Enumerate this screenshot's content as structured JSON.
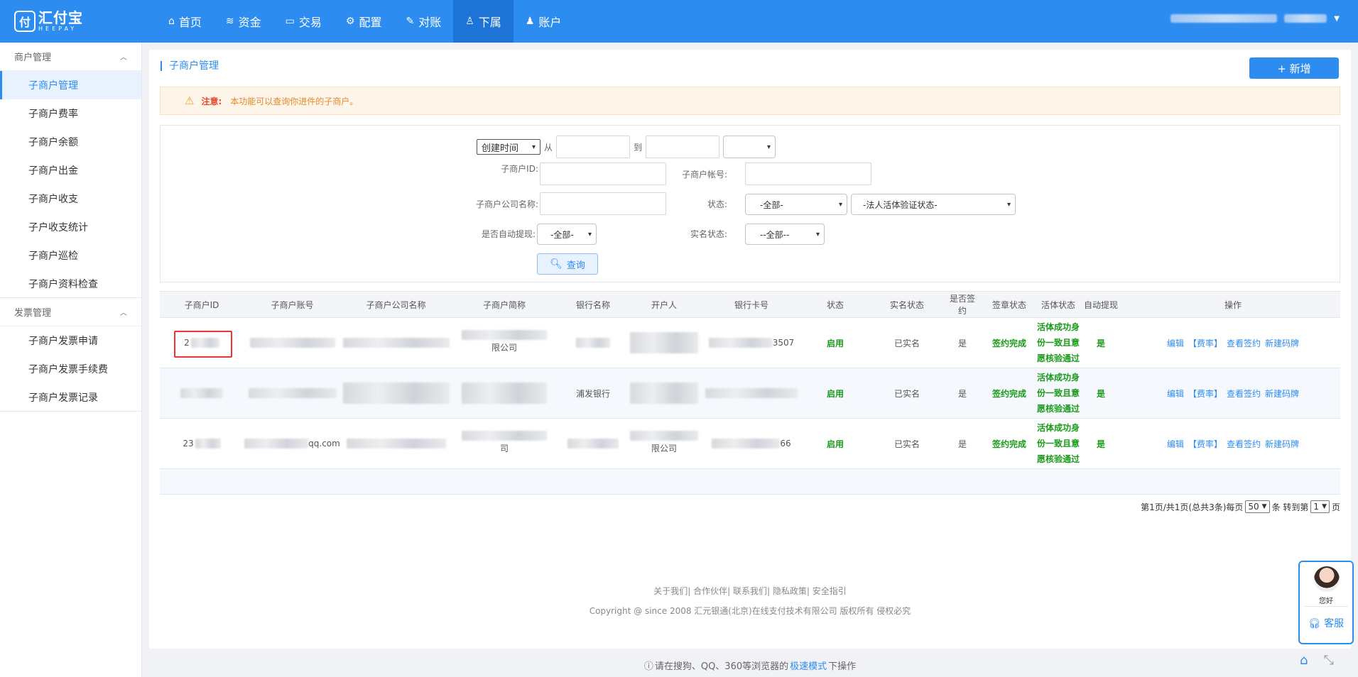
{
  "brand": {
    "logo_mark": "付",
    "name_cn": "汇付宝",
    "name_en": "HEEPAY"
  },
  "nav": [
    {
      "label": "首页",
      "icon": "home-icon"
    },
    {
      "label": "资金",
      "icon": "coins-icon"
    },
    {
      "label": "交易",
      "icon": "folder-icon"
    },
    {
      "label": "配置",
      "icon": "gear-icon"
    },
    {
      "label": "对账",
      "icon": "edit-icon"
    },
    {
      "label": "下属",
      "icon": "user-outline-icon",
      "active": true
    },
    {
      "label": "账户",
      "icon": "user-icon"
    }
  ],
  "sidebar": {
    "group1": "商户管理",
    "items1": [
      "子商户管理",
      "子商户费率",
      "子商户余额",
      "子商户出金",
      "子商户收支",
      "子户收支统计",
      "子商户巡检",
      "子商户资料检查"
    ],
    "group2": "发票管理",
    "items2": [
      "子商户发票申请",
      "子商户发票手续费",
      "子商户发票记录"
    ]
  },
  "page": {
    "breadcrumb": "子商户管理",
    "add_label": "+ 新增",
    "notice_label": "注意:",
    "notice_msg": "本功能可以查询你进件的子商户。"
  },
  "filter": {
    "time_select": "创建时间",
    "from": "从",
    "to": "到",
    "id_label": "子商户ID:",
    "account_label": "子商户帐号:",
    "company_label": "子商户公司名称:",
    "status_label": "状态:",
    "status_select": "-全部-",
    "verify_select": "-法人活体验证状态-",
    "auto_label": "是否自动提现:",
    "auto_select": "-全部-",
    "realname_label": "实名状态:",
    "realname_select": "--全部--",
    "query_label": "查询"
  },
  "table": {
    "headers": [
      "子商户ID",
      "子商户账号",
      "子商户公司名称",
      "子商户简称",
      "银行名称",
      "开户人",
      "银行卡号",
      "状态",
      "实名状态",
      "是否签约",
      "签章状态",
      "活体状态",
      "自动提现",
      "操作"
    ],
    "rows": [
      {
        "id": "2",
        "account": "",
        "company": "",
        "short": "限公司",
        "bank": "",
        "holder": "",
        "card": "3507",
        "status": "启用",
        "realname": "已实名",
        "signed": "是",
        "seal": "签约完成",
        "live": [
          "活体成功身",
          "份一致且意",
          "愿核验通过"
        ],
        "auto": "是"
      },
      {
        "id": "",
        "account": "",
        "company": "",
        "short": "",
        "bank": "浦发银行",
        "holder": "",
        "card": "",
        "status": "启用",
        "realname": "已实名",
        "signed": "是",
        "seal": "签约完成",
        "live": [
          "活体成功身",
          "份一致且意",
          "愿核验通过"
        ],
        "auto": "是"
      },
      {
        "id": "23",
        "account": "qq.com",
        "company": "",
        "short": "司",
        "bank": "",
        "holder": "限公司",
        "card": "66",
        "status": "启用",
        "realname": "已实名",
        "signed": "是",
        "seal": "签约完成",
        "live": [
          "活体成功身",
          "份一致且意",
          "愿核验通过"
        ],
        "auto": "是"
      }
    ],
    "ops": [
      "编辑",
      "【费率】",
      "查看签约",
      "新建码牌"
    ]
  },
  "pager": {
    "summary": "第1页/共1页(总共3条)每页",
    "page_size": "50",
    "unit": "条 转到第",
    "page": "1",
    "suffix": "页"
  },
  "footer": {
    "links": "关于我们| 合作伙伴| 联系我们| 隐私政策| 安全指引",
    "copyright": "Copyright @ since 2008 汇元银通(北京)在线支付技术有限公司 版权所有 侵权必究"
  },
  "bottom": {
    "prefix": "请在搜狗、QQ、360等浏览器的",
    "highlight": "极速模式",
    "suffix": "下操作"
  },
  "kefu": {
    "hello": "您好",
    "label": "客服"
  },
  "colors": {
    "primary": "#2d8cf0",
    "success": "#1a9a1a",
    "warning": "#e3892b",
    "danger": "#e8472c"
  }
}
